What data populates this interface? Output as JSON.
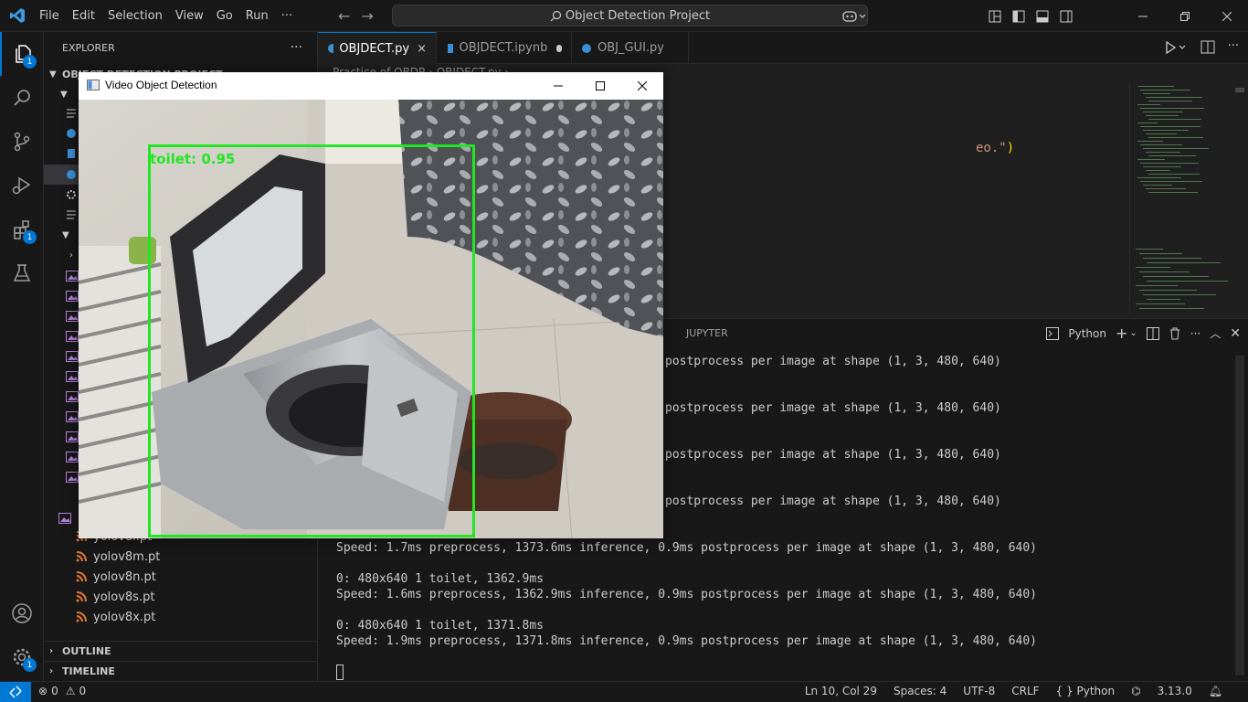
{
  "menu": [
    "File",
    "Edit",
    "Selection",
    "View",
    "Go",
    "Run",
    "···"
  ],
  "command_center": "Object Detection Project",
  "explorer": {
    "title": "EXPLORER",
    "project": "OBJECT DETECTION PROJECT",
    "files": [
      "yolov8l.pt",
      "yolov8m.pt",
      "yolov8n.pt",
      "yolov8s.pt",
      "yolov8x.pt"
    ],
    "outline": "OUTLINE",
    "timeline": "TIMELINE"
  },
  "activity_badges": {
    "explorer": "1",
    "extensions": "1",
    "settings": "1"
  },
  "tabs": [
    {
      "label": "OBJDECT.py",
      "active": true
    },
    {
      "label": "OBJDECT.ipynb",
      "active": false
    },
    {
      "label": "OBJ_GUI.py",
      "active": false
    }
  ],
  "editor": {
    "breadcrumb": "Practice of OBDP  ›  OBJDECT.py  ›  ...",
    "code_fragment_text": "eo.\"",
    "code_fragment_paren": ")"
  },
  "panel": {
    "tab": "JUPYTER",
    "shell": "Python"
  },
  "terminal_lines": [
    "postprocess per image at shape (1, 3, 480, 640)",
    "postprocess per image at shape (1, 3, 480, 640)",
    "postprocess per image at shape (1, 3, 480, 640)",
    "postprocess per image at shape (1, 3, 480, 640)",
    "Speed: 1.7ms preprocess, 1373.6ms inference, 0.9ms postprocess per image at shape (1, 3, 480, 640)",
    "0: 480x640 1 toilet, 1362.9ms",
    "Speed: 1.6ms preprocess, 1362.9ms inference, 0.9ms postprocess per image at shape (1, 3, 480, 640)",
    "0: 480x640 1 toilet, 1371.8ms",
    "Speed: 1.9ms preprocess, 1371.8ms inference, 0.9ms postprocess per image at shape (1, 3, 480, 640)"
  ],
  "status": {
    "errors": "0",
    "warnings": "0",
    "position": "Ln 10, Col 29",
    "spaces": "Spaces: 4",
    "encoding": "UTF-8",
    "eol": "CRLF",
    "language": "Python",
    "version": "3.13.0"
  },
  "detection_window": {
    "title": "Video Object Detection",
    "label": "toilet: 0.95",
    "box_color": "#22e622"
  },
  "colors": {
    "accent": "#0078d4",
    "bg": "#1f1f1f",
    "chrome": "#181818"
  }
}
